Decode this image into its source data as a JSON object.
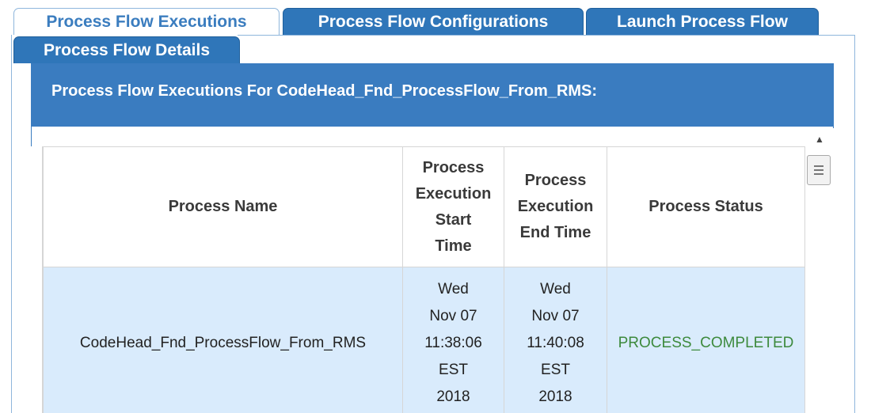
{
  "tabs": {
    "executions": "Process Flow Executions",
    "configurations": "Process Flow Configurations",
    "launch": "Launch Process Flow",
    "details": "Process Flow Details"
  },
  "panel": {
    "title": "Process Flow Executions For CodeHead_Fnd_ProcessFlow_From_RMS:"
  },
  "table": {
    "headers": {
      "name": "Process Name",
      "start": [
        "Process",
        "Execution",
        "Start",
        "Time"
      ],
      "end": [
        "Process",
        "Execution",
        "End Time"
      ],
      "status": "Process Status"
    },
    "rows": [
      {
        "name": "CodeHead_Fnd_ProcessFlow_From_RMS",
        "start": [
          "Wed",
          "Nov 07",
          "11:38:06",
          "EST",
          "2018"
        ],
        "end": [
          "Wed",
          "Nov 07",
          "11:40:08",
          "EST",
          "2018"
        ],
        "status": "PROCESS_COMPLETED"
      }
    ]
  },
  "colors": {
    "tab_blue": "#2f76b9",
    "header_blue": "#3a7cc0",
    "row_highlight": "#d9ebfc",
    "status_green": "#3d8a3d"
  },
  "icons": {
    "scroll_up": "scroll-up-arrow-icon",
    "scroll_thumb": "scroll-thumb-grip-icon"
  }
}
